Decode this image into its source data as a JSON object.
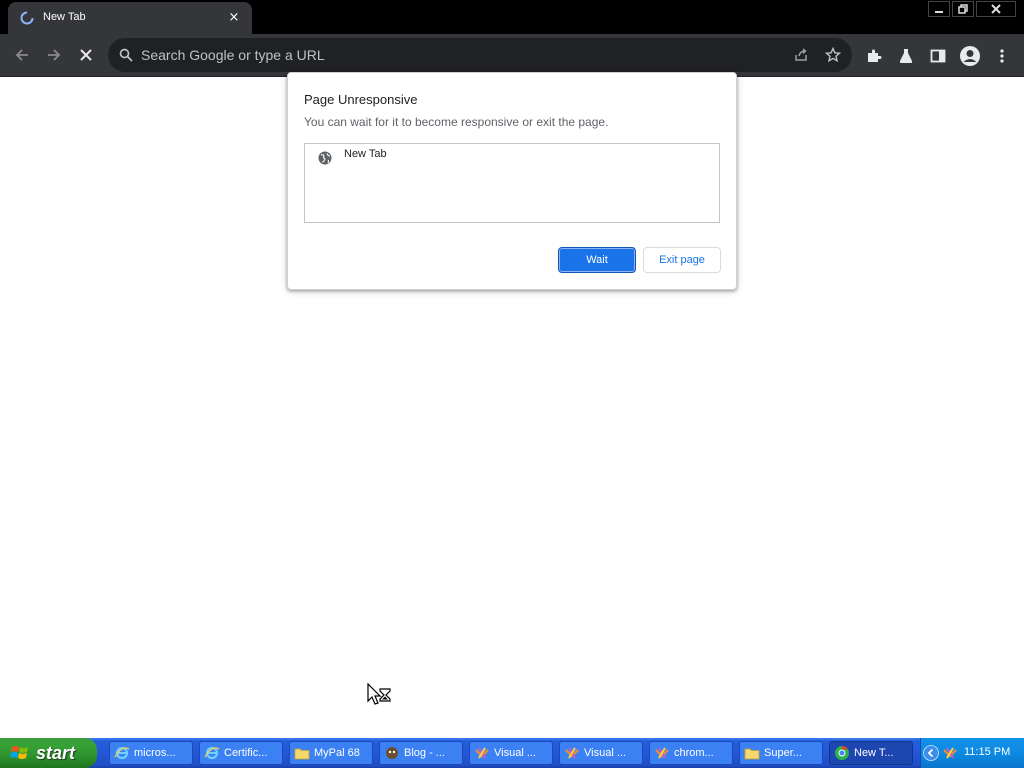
{
  "browser": {
    "tab": {
      "title": "New Tab",
      "close_glyph": "×"
    },
    "omnibox": {
      "placeholder": "Search Google or type a URL"
    },
    "window_controls": {
      "minimize": "minimize-icon",
      "restore": "restore-icon",
      "close": "close-icon"
    },
    "toolbar_icons": [
      "back-arrow-icon",
      "forward-arrow-icon",
      "stop-loading-icon",
      "share-icon",
      "bookmark-star-icon",
      "extensions-puzzle-icon",
      "labs-flask-icon",
      "side-panel-icon",
      "profile-avatar-icon",
      "kebab-menu-icon"
    ]
  },
  "dialog": {
    "title": "Page Unresponsive",
    "message": "You can wait for it to become responsive or exit the page.",
    "pages": [
      {
        "label": "New Tab",
        "icon": "globe-icon"
      }
    ],
    "wait_label": "Wait",
    "exit_label": "Exit page",
    "accent": "#1a73e8"
  },
  "taskbar": {
    "start_label": "start",
    "tasks": [
      {
        "label": "micros...",
        "icon": "ie-icon"
      },
      {
        "label": "Certific...",
        "icon": "ie-icon"
      },
      {
        "label": "MyPal 68",
        "icon": "folder-icon"
      },
      {
        "label": "Blog - ...",
        "icon": "app-icon"
      },
      {
        "label": "Visual ...",
        "icon": "visual-studio-icon"
      },
      {
        "label": "Visual ...",
        "icon": "visual-studio-icon"
      },
      {
        "label": "chrom...",
        "icon": "visual-studio-icon"
      },
      {
        "label": "Super...",
        "icon": "folder-icon"
      },
      {
        "label": "New T...",
        "icon": "chrome-icon"
      }
    ],
    "clock": "11:15 PM"
  },
  "colors": {
    "titlebar": "#000000",
    "toolbar": "#35363a",
    "taskbar": "#245edb",
    "start": "#37a437"
  }
}
